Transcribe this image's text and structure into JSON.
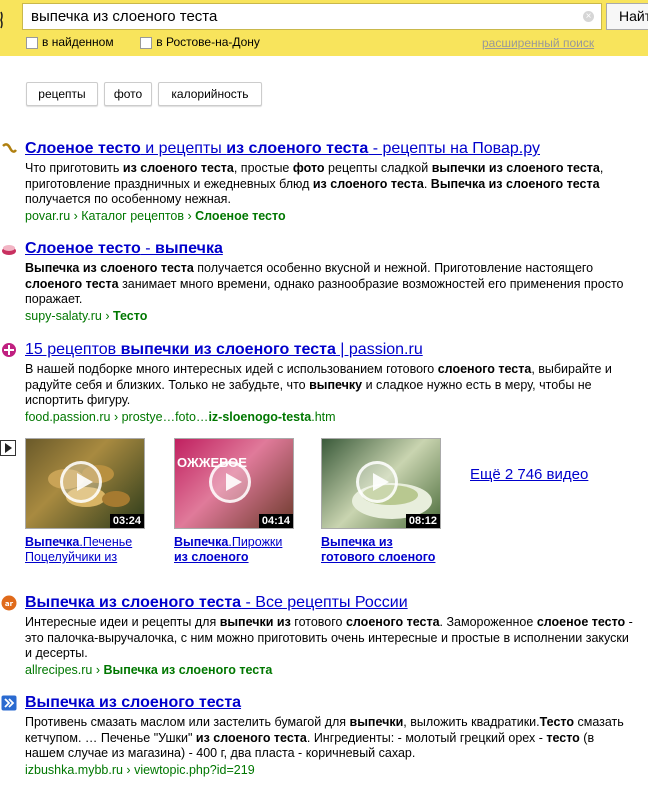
{
  "search": {
    "query": "выпечка из слоеного теста",
    "button_label": "Найти",
    "filter1": "в найденном",
    "filter2": "в Ростове-на-Дону",
    "advanced": "расширенный поиск"
  },
  "pills": [
    "рецепты",
    "фото",
    "калорийность"
  ],
  "results": [
    {
      "title_parts": [
        [
          "Слоеное тесто",
          true
        ],
        [
          " и рецепты ",
          false
        ],
        [
          "из слоеного теста",
          true
        ],
        [
          " - рецепты на Повар.ру",
          false
        ]
      ],
      "snippet_parts": [
        [
          "Что приготовить ",
          false
        ],
        [
          "из слоеного теста",
          true
        ],
        [
          ", простые ",
          false
        ],
        [
          "фото",
          true
        ],
        [
          " рецепты сладкой ",
          false
        ],
        [
          "выпечки из слоеного теста",
          true
        ],
        [
          ", приготовление праздничных и ежедневных блюд ",
          false
        ],
        [
          "из слоеного теста",
          true
        ],
        [
          ". ",
          false
        ],
        [
          "Выпечка из слоеного теста",
          true
        ],
        [
          " получается по особенному нежная.",
          false
        ]
      ],
      "url_parts": [
        [
          "povar.ru › Каталог рецептов › ",
          false
        ],
        [
          "Слоеное тесто",
          true
        ]
      ],
      "icon": "povar-favicon"
    },
    {
      "title_parts": [
        [
          "Слоеное тесто",
          true
        ],
        [
          " - ",
          false
        ],
        [
          "выпечка",
          true
        ]
      ],
      "snippet_parts": [
        [
          "Выпечка из слоеного теста",
          true
        ],
        [
          " получается особенно вкусной и нежной. Приготовление настоящего ",
          false
        ],
        [
          "слоеного теста",
          true
        ],
        [
          " занимает много времени, однако разнообразие возможностей его применения просто поражает.",
          false
        ]
      ],
      "url_parts": [
        [
          "supy-salaty.ru › ",
          false
        ],
        [
          "Тесто",
          true
        ]
      ],
      "icon": "supy-salaty-favicon"
    },
    {
      "title_parts": [
        [
          "15 рецептов ",
          false
        ],
        [
          "выпечки из слоеного теста",
          true
        ],
        [
          " | passion.ru",
          false
        ]
      ],
      "snippet_parts": [
        [
          "В нашей подборке много интересных идей с использованием готового ",
          false
        ],
        [
          "слоеного теста",
          true
        ],
        [
          ", выбирайте и радуйте себя и близких. Только не забудьте, что ",
          false
        ],
        [
          "выпечку",
          true
        ],
        [
          " и сладкое нужно есть в меру, чтобы не испортить фигуру.",
          false
        ]
      ],
      "url_parts": [
        [
          "food.passion.ru › prostye…foto…",
          false
        ],
        [
          "iz-sloenogo-testa",
          true
        ],
        [
          ".htm",
          false
        ]
      ],
      "icon": "passion-favicon"
    },
    {
      "title_parts": [
        [
          "Выпечка из слоеного теста",
          true
        ],
        [
          " - Все рецепты России",
          false
        ]
      ],
      "snippet_parts": [
        [
          "Интересные идеи и рецепты для ",
          false
        ],
        [
          "выпечки из",
          true
        ],
        [
          " готового ",
          false
        ],
        [
          "слоеного теста",
          true
        ],
        [
          ". Замороженное ",
          false
        ],
        [
          "слоеное тесто",
          true
        ],
        [
          " - это палочка-выручалочка, с ним можно приготовить очень интересные и простые в исполнении закуски и десерты.",
          false
        ]
      ],
      "url_parts": [
        [
          "allrecipes.ru › ",
          false
        ],
        [
          "Выпечка из слоеного теста",
          true
        ]
      ],
      "icon": "allrecipes-favicon"
    },
    {
      "title_parts": [
        [
          "Выпечка из слоеного теста",
          true
        ]
      ],
      "snippet_parts": [
        [
          "Противень смазать маслом или застелить бумагой для ",
          false
        ],
        [
          "выпечки",
          true
        ],
        [
          ", выложить квадратики.",
          false
        ],
        [
          "Тесто",
          true
        ],
        [
          " смазать кетчупом. … Печенье \"Ушки\" ",
          false
        ],
        [
          "из слоеного теста",
          true
        ],
        [
          ". Ингредиенты: - молотый грецкий орех - ",
          false
        ],
        [
          "тесто",
          true
        ],
        [
          " (в нашем случае из магазина) - 400 г, два пласта - коричневый сахар.",
          false
        ]
      ],
      "url_parts": [
        [
          "izbushka.mybb.ru › viewtopic.php?id=219",
          false
        ]
      ],
      "icon": "izbushka-favicon"
    }
  ],
  "videos": {
    "items": [
      {
        "duration": "03:24",
        "cap_parts": [
          [
            "Выпечка",
            true
          ],
          [
            ".Печенье ",
            false
          ],
          [
            "Поцелуйчики из",
            false
          ]
        ]
      },
      {
        "duration": "04:14",
        "cap_parts": [
          [
            "Выпечка",
            true
          ],
          [
            ".Пирожки ",
            false
          ],
          [
            "из слоеного",
            true
          ]
        ]
      },
      {
        "duration": "08:12",
        "cap_parts": [
          [
            "Выпечка из",
            true
          ],
          [
            " ",
            false
          ],
          [
            "готового слоеного",
            true
          ]
        ]
      }
    ],
    "more": "Ещё 2 746 видео",
    "thumb2_text": "ОЖЖЕВОЕ"
  }
}
